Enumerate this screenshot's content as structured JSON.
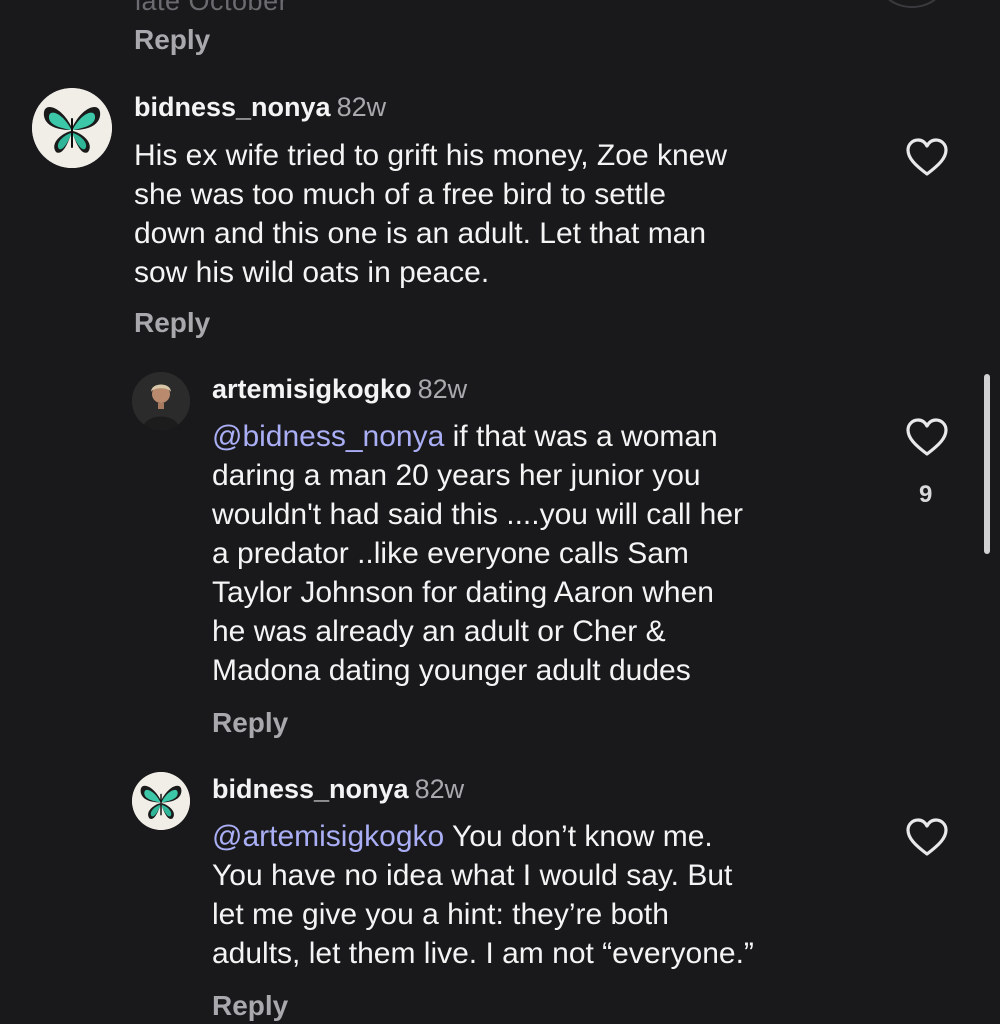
{
  "top": {
    "clipped_text": "late October",
    "reply_label": "Reply"
  },
  "comments": [
    {
      "username": "bidness_nonya",
      "time": "82w",
      "lines": [
        "His ex wife tried to grift his money, Zoe knew",
        "she was too much of a free bird to settle",
        "down and this one is an adult. Let that man",
        "sow his wild oats in peace."
      ],
      "reply_label": "Reply",
      "avatar_icon": "butterfly-icon"
    },
    {
      "username": "artemisigkogko",
      "time": "82w",
      "mention": "@bidness_nonya",
      "lines": [
        " if that was a woman",
        "daring a man 20 years her junior you",
        "wouldn't had said this ....you will call her",
        "a predator ..like everyone calls Sam",
        "Taylor Johnson for dating Aaron when",
        "he was already an adult or Cher &",
        "Madona dating younger adult dudes"
      ],
      "likes": "9",
      "reply_label": "Reply",
      "avatar_icon": "person-photo-icon"
    },
    {
      "username": "bidness_nonya",
      "time": "82w",
      "mention": "@artemisigkogko",
      "lines": [
        " You don’t know me.",
        "You have no idea what I would say. But",
        "let me give you a hint: they’re both",
        "adults, let them live. I am not “everyone.”"
      ],
      "reply_label": "Reply",
      "avatar_icon": "butterfly-icon"
    }
  ],
  "colors": {
    "background": "#19191b",
    "text": "#f4f4f5",
    "muted": "#a8a8ad",
    "mention": "#a9aef5"
  }
}
